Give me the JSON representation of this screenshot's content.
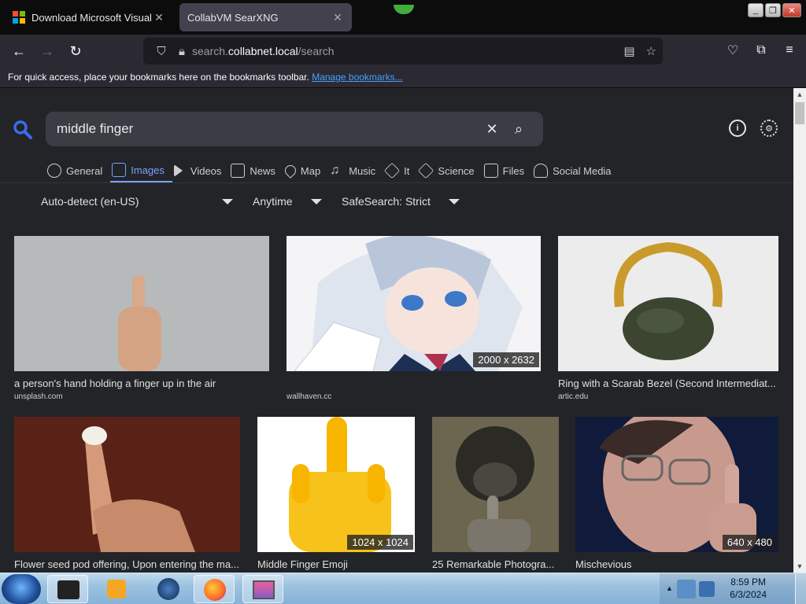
{
  "browser": {
    "tabs": [
      {
        "title": "Download Microsoft Visual C+...",
        "active": false
      },
      {
        "title": "CollabVM SearXNG",
        "active": true
      }
    ],
    "url": {
      "prefix": "search.",
      "domain": "collabnet.local",
      "path": "/search"
    },
    "bookmarks_bar": {
      "text": "For quick access, place your bookmarks here on the bookmarks toolbar.",
      "link": "Manage bookmarks..."
    }
  },
  "search": {
    "query": "middle finger",
    "categories": [
      {
        "label": "General",
        "icon": "search-icon",
        "active": false
      },
      {
        "label": "Images",
        "icon": "image-icon",
        "active": true
      },
      {
        "label": "Videos",
        "icon": "play-icon",
        "active": false
      },
      {
        "label": "News",
        "icon": "newspaper-icon",
        "active": false
      },
      {
        "label": "Map",
        "icon": "map-pin-icon",
        "active": false
      },
      {
        "label": "Music",
        "icon": "music-note-icon",
        "active": false
      },
      {
        "label": "It",
        "icon": "layers-icon",
        "active": false
      },
      {
        "label": "Science",
        "icon": "graduation-cap-icon",
        "active": false
      },
      {
        "label": "Files",
        "icon": "files-icon",
        "active": false
      },
      {
        "label": "Social Media",
        "icon": "people-icon",
        "active": false
      }
    ],
    "filters": {
      "language": "Auto-detect (en-US)",
      "time": "Anytime",
      "safesearch": "SafeSearch: Strict"
    }
  },
  "results": [
    {
      "caption": "a person's hand holding a finger up in the air",
      "source": "unsplash.com",
      "dims": ""
    },
    {
      "caption": "",
      "source": "wallhaven.cc",
      "dims": "2000 x 2632"
    },
    {
      "caption": "Ring with a Scarab Bezel (Second Intermediat...",
      "source": "artic.edu",
      "dims": ""
    },
    {
      "caption": "Flower seed pod offering, Upon entering the ma...",
      "source": "",
      "dims": ""
    },
    {
      "caption": "Middle Finger Emoji",
      "source": "",
      "dims": "1024 x 1024"
    },
    {
      "caption": "25 Remarkable Photogra...",
      "source": "",
      "dims": ""
    },
    {
      "caption": "Mischevious",
      "source": "",
      "dims": "640 x 480"
    }
  ],
  "taskbar": {
    "time": "8:59 PM",
    "date": "6/3/2024"
  },
  "colors": {
    "accent": "#7aa1ff",
    "page_bg": "#222428",
    "search_bg": "#3a3d44"
  }
}
